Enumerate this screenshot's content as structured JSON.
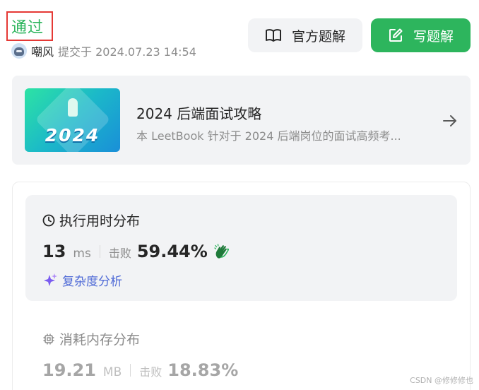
{
  "status": {
    "label": "通过",
    "color": "#2db55d"
  },
  "submission": {
    "user": "嘲风",
    "submitted_text": "提交于 2024.07.23 14:54",
    "avatar_icon": "robot-avatar"
  },
  "actions": {
    "official_solution": {
      "label": "官方题解",
      "icon": "open-book-icon"
    },
    "write_solution": {
      "label": "写题解",
      "icon": "edit-pencil-icon",
      "color": "#2db55d"
    }
  },
  "leetbook": {
    "cover_text": "2024",
    "title": "2024 后端面试攻略",
    "description": "本 LeetBook 针对于 2024 后端岗位的面试高频考...",
    "arrow_icon": "arrow-right-icon"
  },
  "runtime": {
    "title": "执行用时分布",
    "icon": "clock-icon",
    "value": "13",
    "unit": "ms",
    "beat_label": "击败",
    "beat_value": "59.44%",
    "beat_icon": "clapping-hands-icon",
    "complexity_label": "复杂度分析",
    "complexity_icon": "sparkle-icon",
    "accent": "#4f6ad6"
  },
  "memory": {
    "title": "消耗内存分布",
    "icon": "chip-icon",
    "value": "19.21",
    "unit": "MB",
    "beat_label": "击败",
    "beat_value": "18.83%"
  },
  "watermark": "CSDN @修修修也"
}
